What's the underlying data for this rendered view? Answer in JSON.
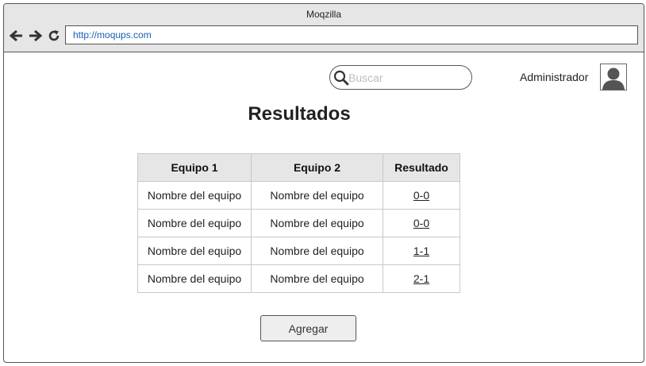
{
  "browser": {
    "window_title": "Moqzilla",
    "url": "http://moqups.com"
  },
  "header": {
    "search": {
      "placeholder": "Buscar",
      "value": ""
    },
    "username": "Administrador"
  },
  "main": {
    "title": "Resultados",
    "table": {
      "headers": [
        "Equipo 1",
        "Equipo 2",
        "Resultado"
      ],
      "rows": [
        {
          "team1": "Nombre del equipo",
          "team2": "Nombre del equipo",
          "result": "0-0"
        },
        {
          "team1": "Nombre del equipo",
          "team2": "Nombre del equipo",
          "result": "0-0"
        },
        {
          "team1": "Nombre del equipo",
          "team2": "Nombre del equipo",
          "result": "1-1"
        },
        {
          "team1": "Nombre del equipo",
          "team2": "Nombre del equipo",
          "result": "2-1"
        }
      ]
    },
    "add_button_label": "Agregar"
  },
  "icons": {
    "back": "arrow-left-icon",
    "forward": "arrow-right-icon",
    "reload": "reload-icon",
    "search": "search-icon",
    "avatar": "user-avatar-icon"
  },
  "colors": {
    "url_text": "#1a5fb4",
    "header_cell_bg": "#e6e6e6",
    "titlebar_bg": "#e6e6e6",
    "button_bg": "#eeeeee"
  }
}
